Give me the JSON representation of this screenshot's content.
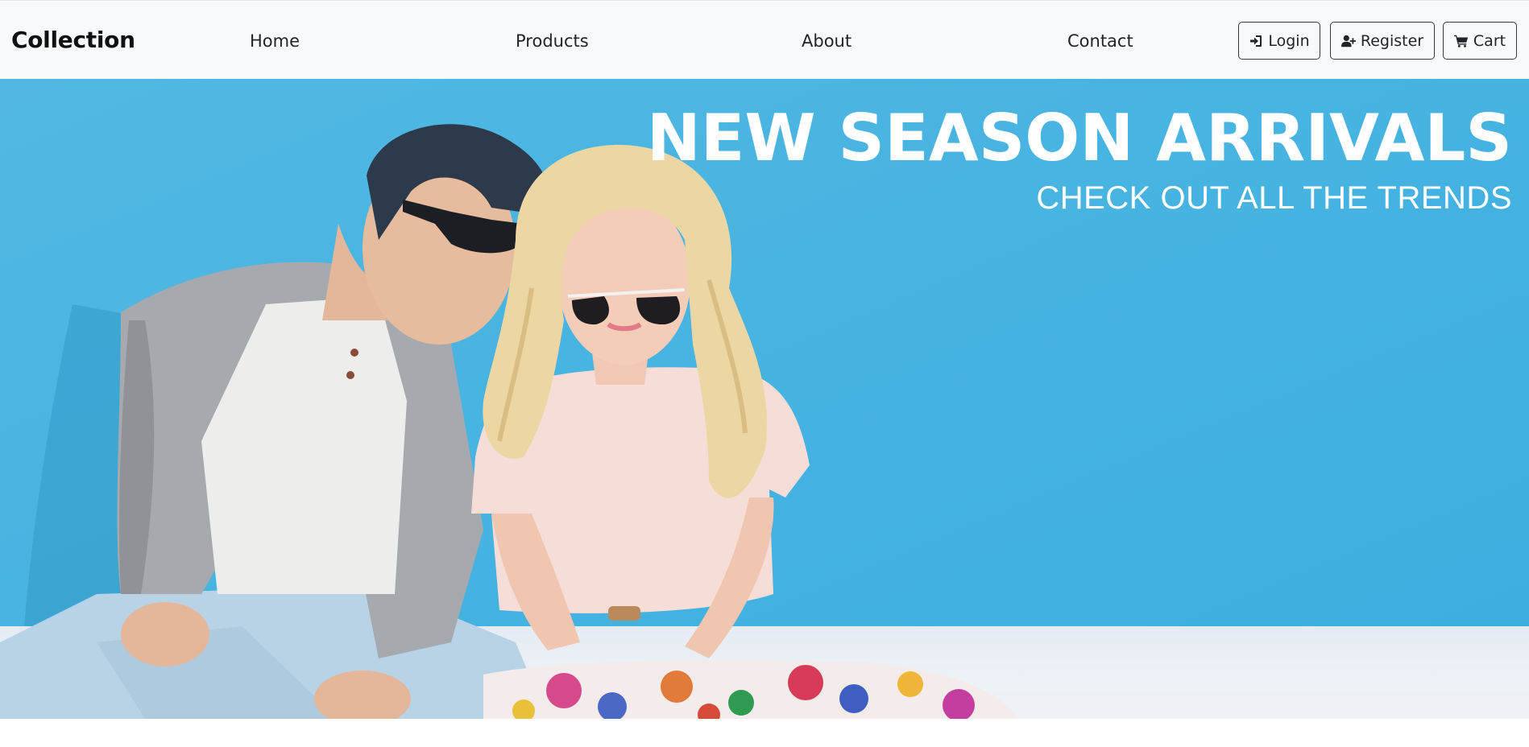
{
  "navbar": {
    "brand": "Collection",
    "links": [
      {
        "label": "Home"
      },
      {
        "label": "Products"
      },
      {
        "label": "About"
      },
      {
        "label": "Contact"
      }
    ],
    "buttons": {
      "login": {
        "label": "Login",
        "icon": "sign-in-icon"
      },
      "register": {
        "label": "Register",
        "icon": "user-plus-icon"
      },
      "cart": {
        "label": "Cart",
        "icon": "shopping-cart-icon"
      }
    }
  },
  "hero": {
    "title": "NEW SEASON ARRIVALS",
    "subtitle": "CHECK OUT ALL THE TRENDS",
    "image": "fashion-couple-photo"
  },
  "colors": {
    "navbar_bg": "#f8f9fa",
    "hero_bg": "#45b5e0",
    "text_dark": "#212529",
    "hero_text": "#ffffff"
  }
}
